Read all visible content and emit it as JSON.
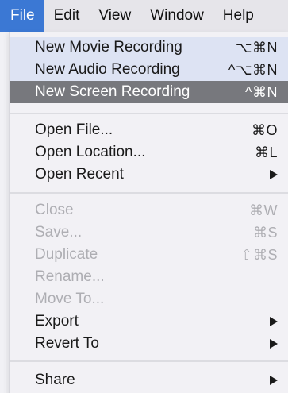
{
  "menubar": {
    "items": [
      "File",
      "Edit",
      "View",
      "Window",
      "Help"
    ],
    "active": "File"
  },
  "menu": {
    "items": [
      {
        "label": "New Movie Recording",
        "shortcut": "⌥⌘N",
        "state": "highlight-light"
      },
      {
        "label": "New Audio Recording",
        "shortcut": "^⌥⌘N",
        "state": "highlight-light"
      },
      {
        "label": "New Screen Recording",
        "shortcut": "^⌘N",
        "state": "highlight"
      },
      {
        "label": "Open File...",
        "shortcut": "⌘O",
        "state": "enabled"
      },
      {
        "label": "Open Location...",
        "shortcut": "⌘L",
        "state": "enabled"
      },
      {
        "label": "Open Recent",
        "submenu": true,
        "state": "enabled"
      },
      {
        "label": "Close",
        "shortcut": "⌘W",
        "state": "disabled"
      },
      {
        "label": "Save...",
        "shortcut": "⌘S",
        "state": "disabled"
      },
      {
        "label": "Duplicate",
        "shortcut": "⇧⌘S",
        "state": "disabled"
      },
      {
        "label": "Rename...",
        "state": "disabled"
      },
      {
        "label": "Move To...",
        "state": "disabled"
      },
      {
        "label": "Export",
        "submenu": true,
        "state": "enabled"
      },
      {
        "label": "Revert To",
        "submenu": true,
        "state": "enabled"
      },
      {
        "label": "Share",
        "submenu": true,
        "state": "enabled"
      }
    ]
  },
  "colors": {
    "active_menu_bg": "#3b78d4",
    "highlight_bg": "#77787d",
    "disabled_text": "#aeaeb3"
  }
}
